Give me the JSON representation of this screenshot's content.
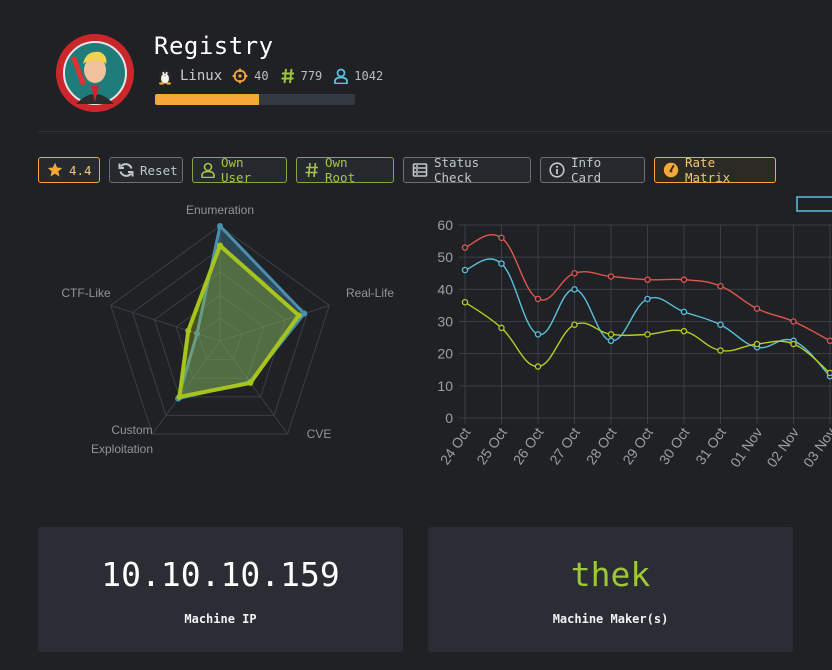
{
  "machine": {
    "name": "Registry",
    "os": "Linux",
    "points": "40",
    "root_owns": "779",
    "user_owns": "1042",
    "progress_fraction": 0.52
  },
  "toolbar": {
    "rating": "4.4",
    "reset": "Reset",
    "own_user": "Own User",
    "own_root": "Own Root",
    "status_check": "Status Check",
    "info_card": "Info Card",
    "rate_matrix": "Rate Matrix"
  },
  "colors": {
    "accent_orange": "#f3a93a",
    "accent_green": "#9fc73a",
    "accent_blue": "#5bc0de",
    "series_red": "#e0564f"
  },
  "icons": {
    "os": "linux-penguin-icon",
    "points": "target-icon",
    "root": "hash-icon",
    "user": "user-icon",
    "rating": "star-icon",
    "reset": "refresh-icon",
    "own_user": "user-icon",
    "own_root": "hash-icon",
    "status": "server-icon",
    "info": "info-icon",
    "rate": "gauge-icon"
  },
  "chart_data": [
    {
      "type": "radar",
      "categories": [
        "Enumeration",
        "Real-Life",
        "CVE",
        "Custom Exploitation",
        "CTF-Like"
      ],
      "max": 10,
      "series": [
        {
          "values": [
            10,
            7.7,
            4.4,
            6.2,
            2.1
          ],
          "color": "#4a8fb0"
        },
        {
          "values": [
            8.3,
            7.2,
            4.5,
            6.0,
            2.9
          ],
          "color": "#a6c41c"
        }
      ]
    },
    {
      "type": "line",
      "categories": [
        "24 Oct",
        "25 Oct",
        "26 Oct",
        "27 Oct",
        "28 Oct",
        "29 Oct",
        "30 Oct",
        "31 Oct",
        "01 Nov",
        "02 Nov",
        "03 Nov"
      ],
      "ylim": [
        0,
        60
      ],
      "yticks": [
        0,
        10,
        20,
        30,
        40,
        50,
        60
      ],
      "grid": true,
      "series": [
        {
          "color": "#e0564f",
          "values": [
            53,
            56,
            37,
            45,
            44,
            43,
            43,
            41,
            34,
            30,
            24
          ]
        },
        {
          "color": "#5bc0de",
          "values": [
            46,
            48,
            26,
            40,
            24,
            37,
            33,
            29,
            22,
            24,
            13
          ]
        },
        {
          "color": "#b5cc2a",
          "values": [
            36,
            28,
            16,
            29,
            26,
            26,
            27,
            21,
            23,
            23,
            14
          ]
        }
      ]
    }
  ],
  "cards": {
    "ip_value": "10.10.10.159",
    "ip_label": "Machine IP",
    "maker_value": "thek",
    "maker_label": "Machine Maker(s)"
  }
}
